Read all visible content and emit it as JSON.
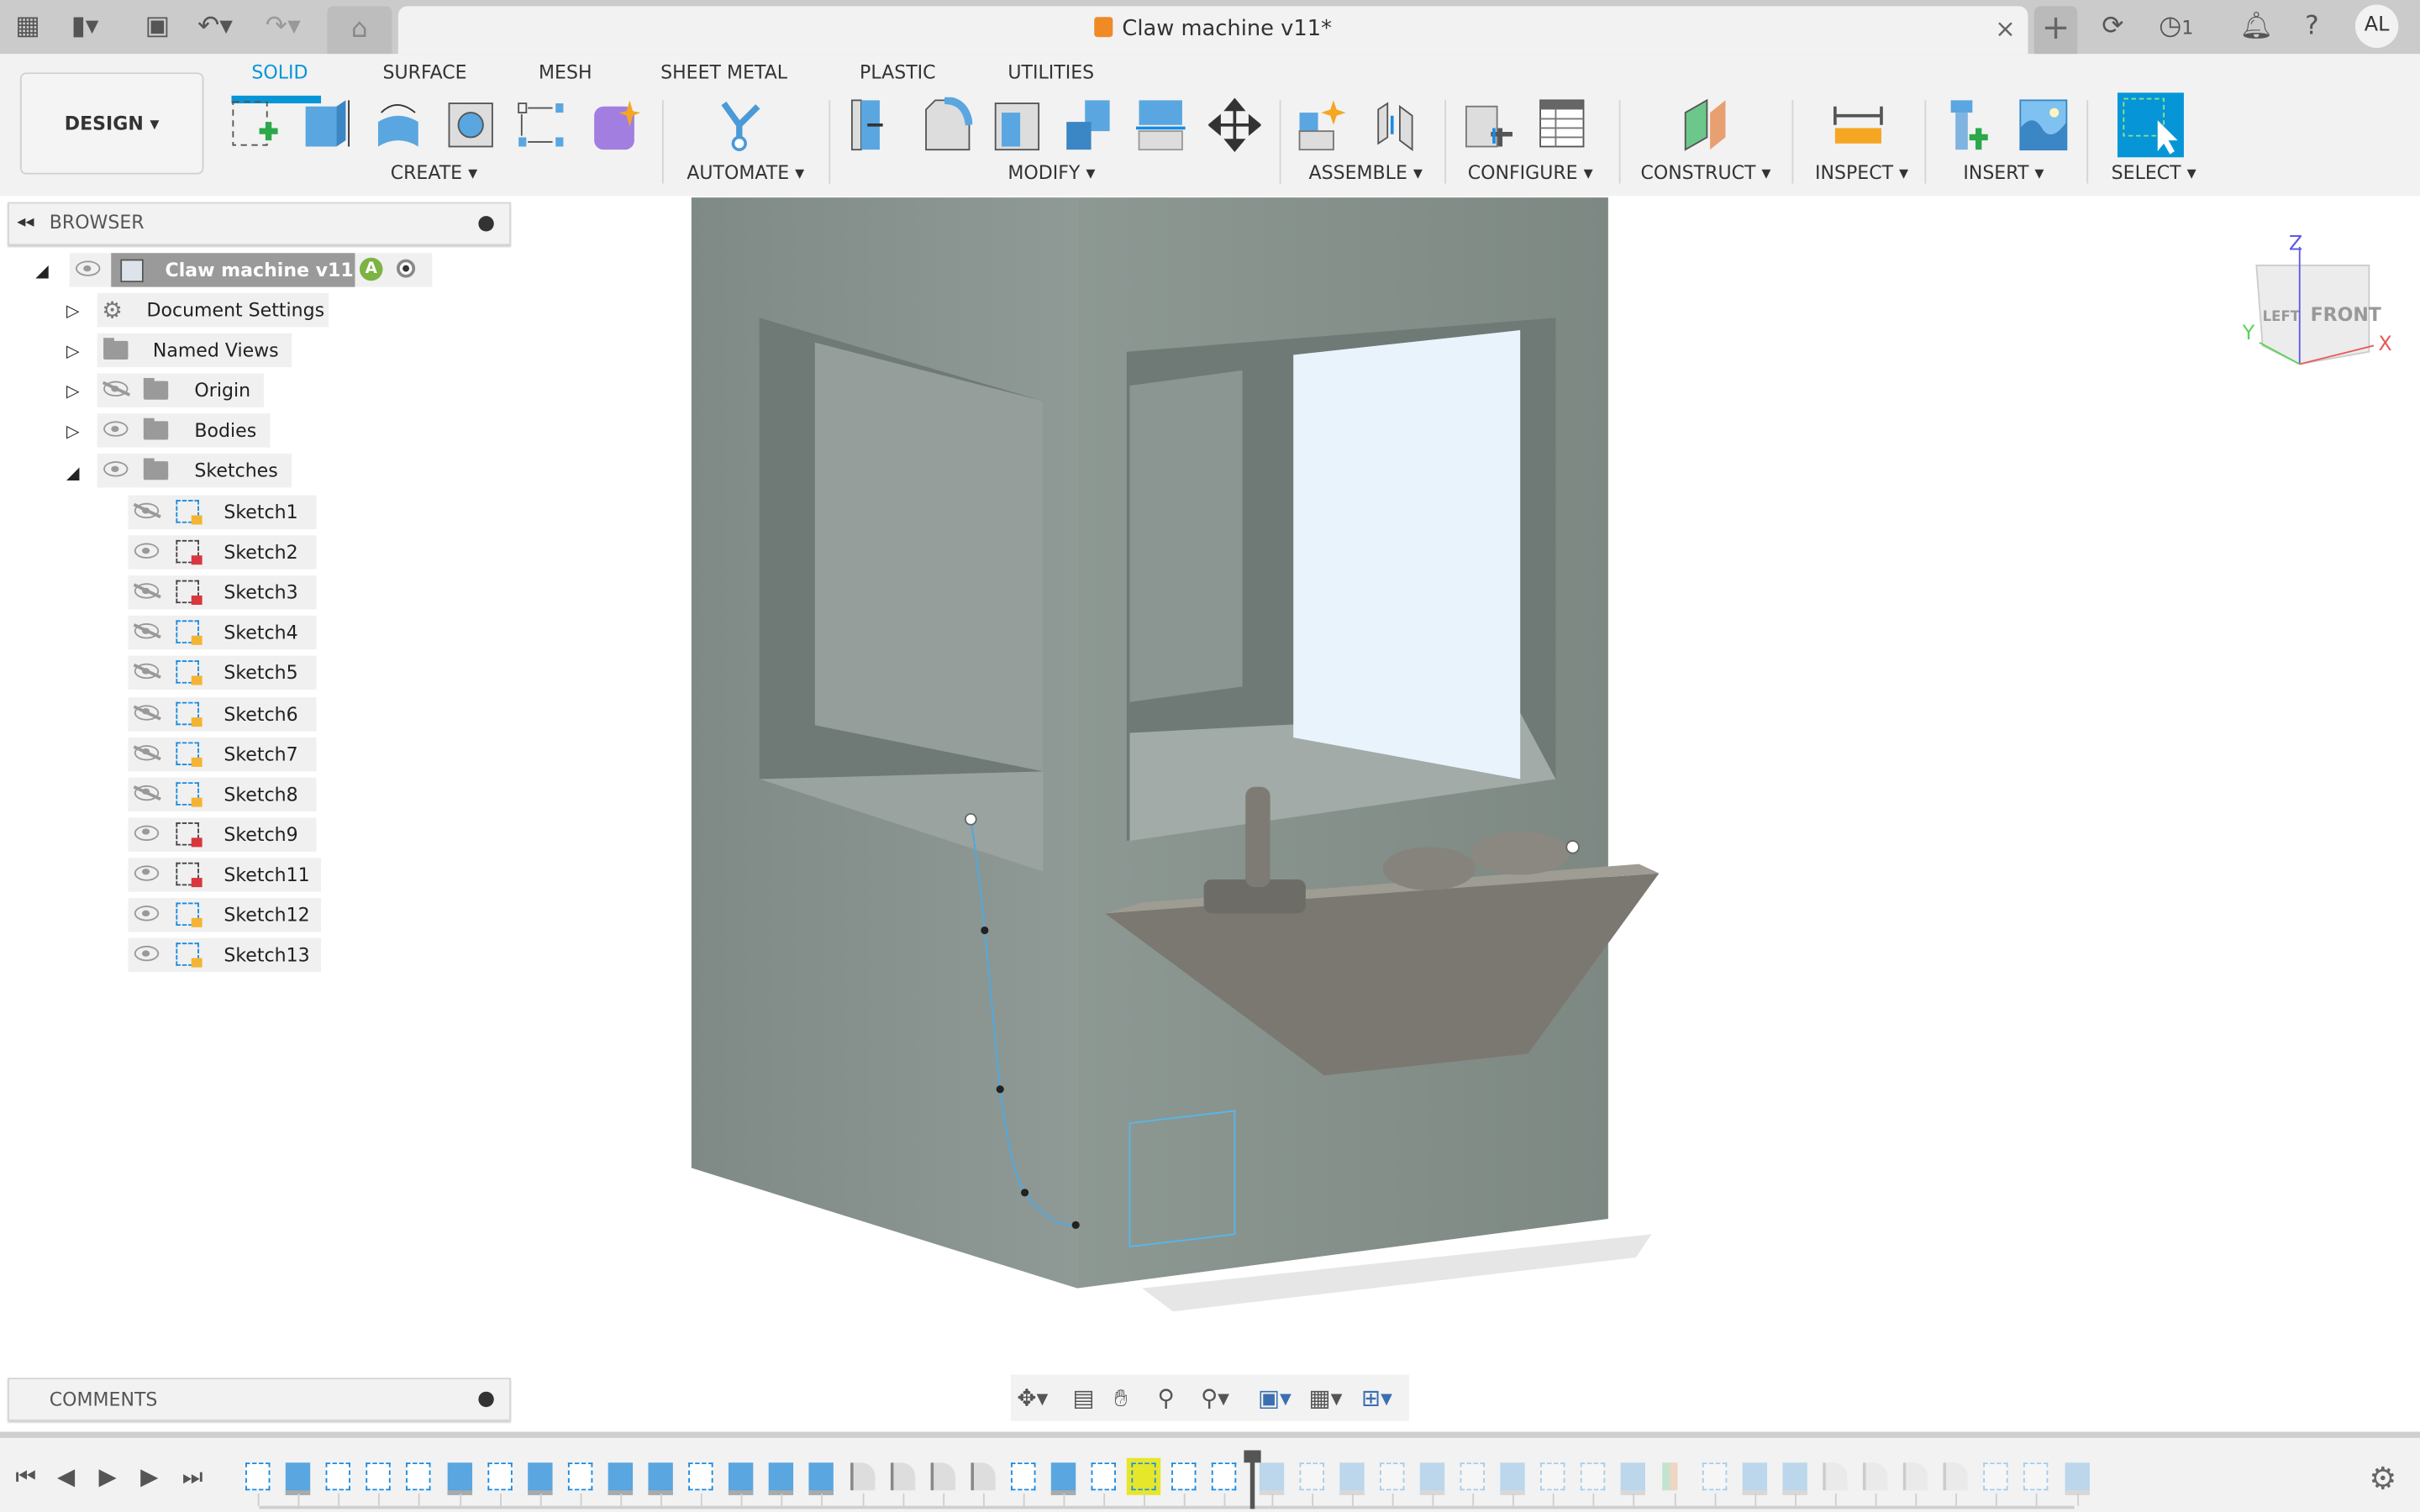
{
  "titlebar": {
    "document_title": "Claw machine v11*",
    "close": "×",
    "new_tab": "+",
    "jobs_count": "1",
    "user_initials": "AL"
  },
  "toolbar": {
    "workspace": "DESIGN ▾",
    "tabs": [
      "SOLID",
      "SURFACE",
      "MESH",
      "SHEET METAL",
      "PLASTIC",
      "UTILITIES"
    ],
    "active_tab": "SOLID",
    "groups": [
      "CREATE ▾",
      "AUTOMATE ▾",
      "MODIFY ▾",
      "ASSEMBLE ▾",
      "CONFIGURE ▾",
      "CONSTRUCT ▾",
      "INSPECT ▾",
      "INSERT ▾",
      "SELECT ▾"
    ]
  },
  "browser": {
    "title": "BROWSER",
    "root": "Claw machine v11",
    "root_badge": "A",
    "items": [
      {
        "label": "Document Settings",
        "icon": "gear-icon"
      },
      {
        "label": "Named Views",
        "icon": "folder-icon"
      },
      {
        "label": "Origin",
        "icon": "folder-icon",
        "visible": false
      },
      {
        "label": "Bodies",
        "icon": "folder-icon",
        "visible": true
      },
      {
        "label": "Sketches",
        "icon": "folder-icon",
        "visible": true,
        "expanded": true
      }
    ],
    "sketches": [
      {
        "label": "Sketch1",
        "visible": false,
        "locked": false
      },
      {
        "label": "Sketch2",
        "visible": true,
        "locked": true
      },
      {
        "label": "Sketch3",
        "visible": false,
        "locked": true
      },
      {
        "label": "Sketch4",
        "visible": false,
        "locked": false
      },
      {
        "label": "Sketch5",
        "visible": false,
        "locked": false
      },
      {
        "label": "Sketch6",
        "visible": false,
        "locked": false
      },
      {
        "label": "Sketch7",
        "visible": false,
        "locked": false
      },
      {
        "label": "Sketch8",
        "visible": false,
        "locked": false
      },
      {
        "label": "Sketch9",
        "visible": true,
        "locked": true
      },
      {
        "label": "Sketch11",
        "visible": true,
        "locked": true
      },
      {
        "label": "Sketch12",
        "visible": true,
        "locked": false
      },
      {
        "label": "Sketch13",
        "visible": true,
        "locked": false
      }
    ]
  },
  "comments": {
    "title": "COMMENTS"
  },
  "viewcube": {
    "faces": [
      "LEFT",
      "FRONT"
    ],
    "axes": {
      "x": "X",
      "y": "Y",
      "z": "Z"
    },
    "colors": {
      "x": "#e85a5a",
      "y": "#5ad35a",
      "z": "#5a5ae8"
    }
  },
  "timeline": {
    "features": [
      "sketch",
      "extrude",
      "sketch",
      "sketch",
      "sketch",
      "extrude",
      "sketch",
      "extrude",
      "sketch",
      "extrude",
      "extrude",
      "sketch",
      "extrude",
      "extrude",
      "extrude",
      "fillet",
      "fillet",
      "fillet",
      "fillet",
      "sketch",
      "extrude",
      "sketch",
      "sketch",
      "sketch",
      "sketch",
      "extrude",
      "sketch",
      "extrude",
      "sketch",
      "extrude",
      "sketch",
      "extrude",
      "sketch",
      "sketch",
      "extrude",
      "plane",
      "sketch",
      "extrude",
      "extrude",
      "fillet",
      "fillet",
      "fillet",
      "fillet",
      "sketch",
      "sketch",
      "extrude"
    ],
    "marker_after": 25,
    "highlighted": 22
  },
  "colors": {
    "accent": "#0696d7",
    "body": "#8c9690",
    "highlight": "#e6e62a"
  }
}
